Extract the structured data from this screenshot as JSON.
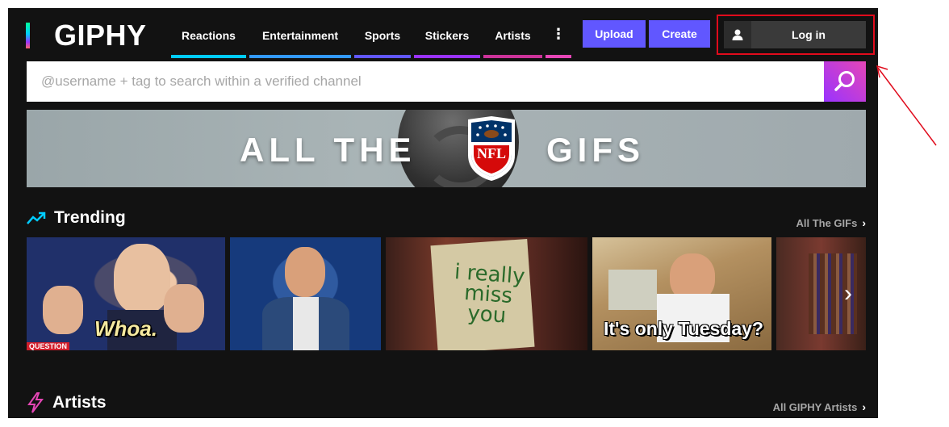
{
  "header": {
    "logo": "GIPHY",
    "nav": [
      {
        "label": "Reactions"
      },
      {
        "label": "Entertainment"
      },
      {
        "label": "Sports"
      },
      {
        "label": "Stickers"
      },
      {
        "label": "Artists"
      },
      {
        "label": "⋮"
      }
    ],
    "upload_label": "Upload",
    "create_label": "Create",
    "login_label": "Log in"
  },
  "search": {
    "placeholder": "@username + tag to search within a verified channel"
  },
  "banner": {
    "left_text": "ALL THE",
    "logo_text": "NFL",
    "right_text": "GIFS"
  },
  "trending": {
    "title": "Trending",
    "link_label": "All The GIFs",
    "gifs": [
      {
        "caption": "Whoa.",
        "badge": "QUESTION"
      },
      {
        "caption": ""
      },
      {
        "caption": "i really miss you"
      },
      {
        "caption": "It's only Tuesday?"
      },
      {
        "caption": ""
      }
    ]
  },
  "artists": {
    "title": "Artists",
    "link_label": "All GIPHY Artists"
  },
  "colors": {
    "brand_purple": "#6157ff",
    "highlight_red": "#e00b1c",
    "background": "#121212"
  }
}
